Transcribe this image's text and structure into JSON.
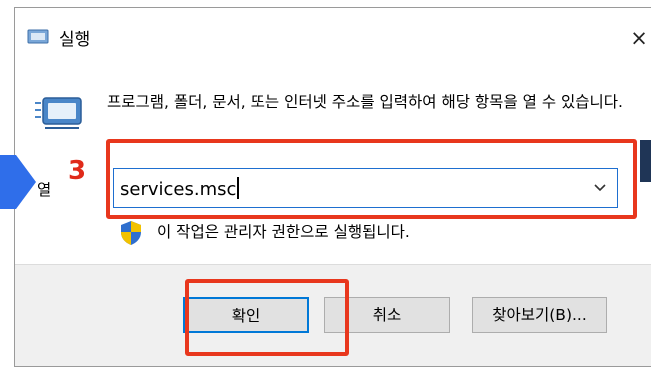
{
  "window": {
    "title": "실행",
    "close_glyph": "×",
    "icons": {
      "title": "run-icon",
      "close": "close-icon"
    }
  },
  "content": {
    "description": "프로그램, 폴더, 문서, 또는 인터넷 주소를 입력하여 해당 항목을 열 수 있습니다.",
    "open_label": "열",
    "input_value": "services.msc",
    "admin_notice": "이 작업은 관리자 권한으로 실행됩니다.",
    "icons": {
      "run": "run-icon",
      "dropdown": "chevron-down-icon",
      "shield": "shield-icon"
    }
  },
  "buttons": {
    "ok": "확인",
    "cancel": "취소",
    "browse": "찾아보기(B)..."
  },
  "annotation": {
    "step_number": "3",
    "highlight_color": "#e8371d",
    "pointer_color": "#2f6eea"
  },
  "colors": {
    "focus_border": "#0078d7",
    "footer_bg": "#f0f0f0",
    "button_bg": "#e1e1e1"
  }
}
